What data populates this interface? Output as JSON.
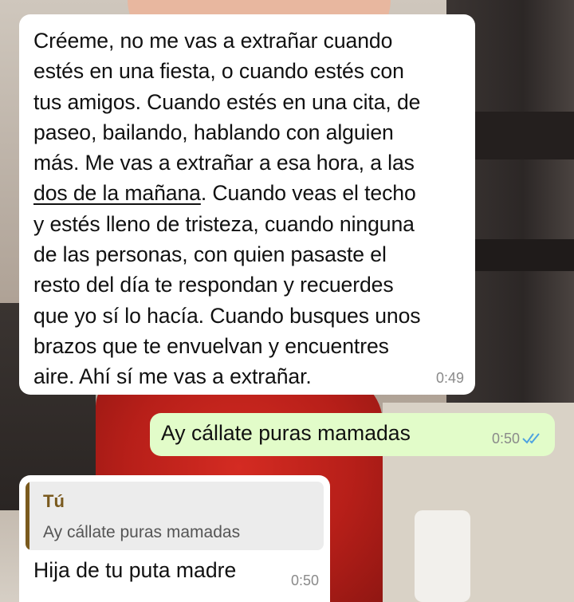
{
  "messages": [
    {
      "direction": "incoming",
      "text_before_underline": "Créeme, no me vas a extrañar cuando\nestés en una fiesta, o cuando estés con\ntus amigos. Cuando estés en una cita, de\npaseo, bailando, hablando con alguien\nmás. Me vas a extrañar a esa hora, a las\n",
      "underlined_text": "dos de la mañana",
      "text_after_underline": ". Cuando veas el techo\ny estés lleno de tristeza, cuando ninguna\nde las personas, con quien pasaste el\nresto del día te respondan y recuerdes\nque yo sí lo hacía. Cuando busques unos\nbrazos que te envuelvan y encuentres\naire. Ahí sí me vas a extrañar.",
      "time": "0:49"
    },
    {
      "direction": "outgoing",
      "text": "Ay cállate puras mamadas",
      "time": "0:50",
      "status_icon": "double-check-read-icon"
    },
    {
      "direction": "incoming",
      "quoted_author": "Tú",
      "quoted_text": "Ay cállate puras mamadas",
      "text": "Hija de tu puta madre",
      "time": "0:50"
    }
  ],
  "colors": {
    "incoming_bubble": "#ffffff",
    "outgoing_bubble": "#e2fcc9",
    "read_ticks": "#4fa3e0",
    "quote_accent": "#7a5a1e"
  }
}
